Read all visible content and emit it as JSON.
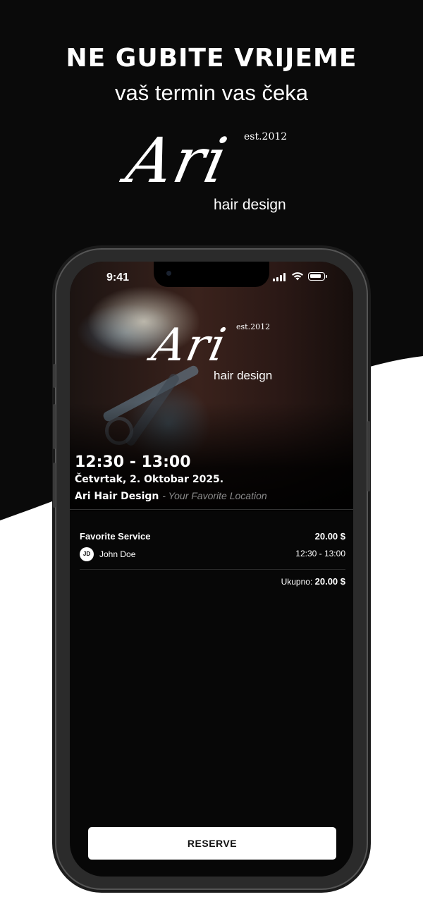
{
  "promo": {
    "headline": "NE GUBITE VRIJEME",
    "subline": "vaš termin vas čeka"
  },
  "brand": {
    "script": "Ari",
    "est": "est.2012",
    "tagline": "hair design"
  },
  "status_bar": {
    "time": "9:41"
  },
  "booking": {
    "time_range": "12:30 - 13:00",
    "date": "Četvrtak, 2. Oktobar 2025.",
    "salon": "Ari Hair Design",
    "location": "- Your Favorite Location"
  },
  "service": {
    "name": "Favorite Service",
    "price": "20.00 $",
    "staff_initials": "JD",
    "staff_name": "John Doe",
    "time": "12:30 - 13:00"
  },
  "total": {
    "label": "Ukupno:",
    "amount": "20.00 $"
  },
  "actions": {
    "reserve_label": "RESERVE"
  },
  "colors": {
    "background": "#0a0a0a",
    "wave": "#ffffff",
    "button": "#ffffff"
  }
}
